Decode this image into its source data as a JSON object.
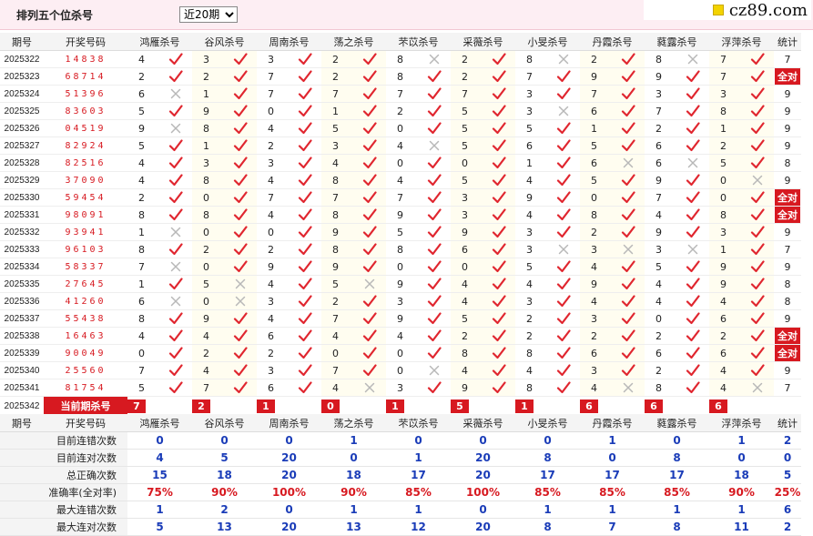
{
  "header": {
    "title": "排列五个位杀号",
    "select_value": "近20期",
    "brand": "cz89.com"
  },
  "columns": [
    "期号",
    "开奖号码",
    "鸿雁杀号",
    "谷风杀号",
    "周南杀号",
    "荡之杀号",
    "芣苡杀号",
    "采薇杀号",
    "小旻杀号",
    "丹霞杀号",
    "蕤露杀号",
    "浮萍杀号",
    "统计"
  ],
  "rows": [
    {
      "period": "2025322",
      "draw": "14838",
      "k": [
        [
          "4",
          1
        ],
        [
          "3",
          1
        ],
        [
          "3",
          1
        ],
        [
          "2",
          1
        ],
        [
          "8",
          0
        ],
        [
          "2",
          1
        ],
        [
          "8",
          0
        ],
        [
          "2",
          1
        ],
        [
          "8",
          0
        ],
        [
          "7",
          1
        ]
      ],
      "stat": "7"
    },
    {
      "period": "2025323",
      "draw": "68714",
      "k": [
        [
          "2",
          1
        ],
        [
          "2",
          1
        ],
        [
          "7",
          1
        ],
        [
          "2",
          1
        ],
        [
          "8",
          1
        ],
        [
          "2",
          1
        ],
        [
          "7",
          1
        ],
        [
          "9",
          1
        ],
        [
          "9",
          1
        ],
        [
          "7",
          1
        ]
      ],
      "stat": "全对"
    },
    {
      "period": "2025324",
      "draw": "51396",
      "k": [
        [
          "6",
          0
        ],
        [
          "1",
          1
        ],
        [
          "7",
          1
        ],
        [
          "7",
          1
        ],
        [
          "7",
          1
        ],
        [
          "7",
          1
        ],
        [
          "3",
          1
        ],
        [
          "7",
          1
        ],
        [
          "3",
          1
        ],
        [
          "3",
          1
        ]
      ],
      "stat": "9"
    },
    {
      "period": "2025325",
      "draw": "83603",
      "k": [
        [
          "5",
          1
        ],
        [
          "9",
          1
        ],
        [
          "0",
          1
        ],
        [
          "1",
          1
        ],
        [
          "2",
          1
        ],
        [
          "5",
          1
        ],
        [
          "3",
          0
        ],
        [
          "6",
          1
        ],
        [
          "7",
          1
        ],
        [
          "8",
          1
        ]
      ],
      "stat": "9"
    },
    {
      "period": "2025326",
      "draw": "04519",
      "k": [
        [
          "9",
          0
        ],
        [
          "8",
          1
        ],
        [
          "4",
          1
        ],
        [
          "5",
          1
        ],
        [
          "0",
          1
        ],
        [
          "5",
          1
        ],
        [
          "5",
          1
        ],
        [
          "1",
          1
        ],
        [
          "2",
          1
        ],
        [
          "1",
          1
        ]
      ],
      "stat": "9"
    },
    {
      "period": "2025327",
      "draw": "82924",
      "k": [
        [
          "5",
          1
        ],
        [
          "1",
          1
        ],
        [
          "2",
          1
        ],
        [
          "3",
          1
        ],
        [
          "4",
          0
        ],
        [
          "5",
          1
        ],
        [
          "6",
          1
        ],
        [
          "5",
          1
        ],
        [
          "6",
          1
        ],
        [
          "2",
          1
        ]
      ],
      "stat": "9"
    },
    {
      "period": "2025328",
      "draw": "82516",
      "k": [
        [
          "4",
          1
        ],
        [
          "3",
          1
        ],
        [
          "3",
          1
        ],
        [
          "4",
          1
        ],
        [
          "0",
          1
        ],
        [
          "0",
          1
        ],
        [
          "1",
          1
        ],
        [
          "6",
          0
        ],
        [
          "6",
          0
        ],
        [
          "5",
          1
        ]
      ],
      "stat": "8"
    },
    {
      "period": "2025329",
      "draw": "37090",
      "k": [
        [
          "4",
          1
        ],
        [
          "8",
          1
        ],
        [
          "4",
          1
        ],
        [
          "8",
          1
        ],
        [
          "4",
          1
        ],
        [
          "5",
          1
        ],
        [
          "4",
          1
        ],
        [
          "5",
          1
        ],
        [
          "9",
          1
        ],
        [
          "0",
          0
        ]
      ],
      "stat": "9"
    },
    {
      "period": "2025330",
      "draw": "59454",
      "k": [
        [
          "2",
          1
        ],
        [
          "0",
          1
        ],
        [
          "7",
          1
        ],
        [
          "7",
          1
        ],
        [
          "7",
          1
        ],
        [
          "3",
          1
        ],
        [
          "9",
          1
        ],
        [
          "0",
          1
        ],
        [
          "7",
          1
        ],
        [
          "0",
          1
        ]
      ],
      "stat": "全对"
    },
    {
      "period": "2025331",
      "draw": "98091",
      "k": [
        [
          "8",
          1
        ],
        [
          "8",
          1
        ],
        [
          "4",
          1
        ],
        [
          "8",
          1
        ],
        [
          "9",
          1
        ],
        [
          "3",
          1
        ],
        [
          "4",
          1
        ],
        [
          "8",
          1
        ],
        [
          "4",
          1
        ],
        [
          "8",
          1
        ]
      ],
      "stat": "全对"
    },
    {
      "period": "2025332",
      "draw": "93941",
      "k": [
        [
          "1",
          0
        ],
        [
          "0",
          1
        ],
        [
          "0",
          1
        ],
        [
          "9",
          1
        ],
        [
          "5",
          1
        ],
        [
          "9",
          1
        ],
        [
          "3",
          1
        ],
        [
          "2",
          1
        ],
        [
          "9",
          1
        ],
        [
          "3",
          1
        ]
      ],
      "stat": "9"
    },
    {
      "period": "2025333",
      "draw": "96103",
      "k": [
        [
          "8",
          1
        ],
        [
          "2",
          1
        ],
        [
          "2",
          1
        ],
        [
          "8",
          1
        ],
        [
          "8",
          1
        ],
        [
          "6",
          1
        ],
        [
          "3",
          0
        ],
        [
          "3",
          0
        ],
        [
          "3",
          0
        ],
        [
          "1",
          1
        ]
      ],
      "stat": "7"
    },
    {
      "period": "2025334",
      "draw": "58337",
      "k": [
        [
          "7",
          0
        ],
        [
          "0",
          1
        ],
        [
          "9",
          1
        ],
        [
          "9",
          1
        ],
        [
          "0",
          1
        ],
        [
          "0",
          1
        ],
        [
          "5",
          1
        ],
        [
          "4",
          1
        ],
        [
          "5",
          1
        ],
        [
          "9",
          1
        ]
      ],
      "stat": "9"
    },
    {
      "period": "2025335",
      "draw": "27645",
      "k": [
        [
          "1",
          1
        ],
        [
          "5",
          0
        ],
        [
          "4",
          1
        ],
        [
          "5",
          0
        ],
        [
          "9",
          1
        ],
        [
          "4",
          1
        ],
        [
          "4",
          1
        ],
        [
          "9",
          1
        ],
        [
          "4",
          1
        ],
        [
          "9",
          1
        ]
      ],
      "stat": "8"
    },
    {
      "period": "2025336",
      "draw": "41260",
      "k": [
        [
          "6",
          0
        ],
        [
          "0",
          0
        ],
        [
          "3",
          1
        ],
        [
          "2",
          1
        ],
        [
          "3",
          1
        ],
        [
          "4",
          1
        ],
        [
          "3",
          1
        ],
        [
          "4",
          1
        ],
        [
          "4",
          1
        ],
        [
          "4",
          1
        ]
      ],
      "stat": "8"
    },
    {
      "period": "2025337",
      "draw": "55438",
      "k": [
        [
          "8",
          1
        ],
        [
          "9",
          1
        ],
        [
          "4",
          1
        ],
        [
          "7",
          1
        ],
        [
          "9",
          1
        ],
        [
          "5",
          1
        ],
        [
          "2",
          1
        ],
        [
          "3",
          1
        ],
        [
          "0",
          1
        ],
        [
          "6",
          1
        ]
      ],
      "stat": "9"
    },
    {
      "period": "2025338",
      "draw": "16463",
      "k": [
        [
          "4",
          1
        ],
        [
          "4",
          1
        ],
        [
          "6",
          1
        ],
        [
          "4",
          1
        ],
        [
          "4",
          1
        ],
        [
          "2",
          1
        ],
        [
          "2",
          1
        ],
        [
          "2",
          1
        ],
        [
          "2",
          1
        ],
        [
          "2",
          1
        ]
      ],
      "stat": "全对"
    },
    {
      "period": "2025339",
      "draw": "90049",
      "k": [
        [
          "0",
          1
        ],
        [
          "2",
          1
        ],
        [
          "2",
          1
        ],
        [
          "0",
          1
        ],
        [
          "0",
          1
        ],
        [
          "8",
          1
        ],
        [
          "8",
          1
        ],
        [
          "6",
          1
        ],
        [
          "6",
          1
        ],
        [
          "6",
          1
        ]
      ],
      "stat": "全对"
    },
    {
      "period": "2025340",
      "draw": "25560",
      "k": [
        [
          "7",
          1
        ],
        [
          "4",
          1
        ],
        [
          "3",
          1
        ],
        [
          "7",
          1
        ],
        [
          "0",
          0
        ],
        [
          "4",
          1
        ],
        [
          "4",
          1
        ],
        [
          "3",
          1
        ],
        [
          "2",
          1
        ],
        [
          "4",
          1
        ]
      ],
      "stat": "9"
    },
    {
      "period": "2025341",
      "draw": "81754",
      "k": [
        [
          "5",
          1
        ],
        [
          "7",
          1
        ],
        [
          "6",
          1
        ],
        [
          "4",
          0
        ],
        [
          "3",
          1
        ],
        [
          "9",
          1
        ],
        [
          "8",
          1
        ],
        [
          "4",
          0
        ],
        [
          "8",
          1
        ],
        [
          "4",
          0
        ]
      ],
      "stat": "7"
    }
  ],
  "current": {
    "period": "2025342",
    "label": "当前期杀号",
    "values": [
      "7",
      "2",
      "1",
      "0",
      "1",
      "5",
      "1",
      "6",
      "6",
      "6"
    ]
  },
  "summary": {
    "labels": [
      "目前连错次数",
      "目前连对次数",
      "总正确次数",
      "准确率(全对率)",
      "最大连错次数",
      "最大连对次数"
    ],
    "values": [
      [
        "0",
        "0",
        "0",
        "1",
        "0",
        "0",
        "0",
        "1",
        "0",
        "1",
        "2"
      ],
      [
        "4",
        "5",
        "20",
        "0",
        "1",
        "20",
        "8",
        "0",
        "8",
        "0",
        "0"
      ],
      [
        "15",
        "18",
        "20",
        "18",
        "17",
        "20",
        "17",
        "17",
        "17",
        "18",
        "5"
      ],
      [
        "75%",
        "90%",
        "100%",
        "90%",
        "85%",
        "100%",
        "85%",
        "85%",
        "85%",
        "90%",
        "25%"
      ],
      [
        "1",
        "2",
        "0",
        "1",
        "1",
        "0",
        "1",
        "1",
        "1",
        "1",
        "6"
      ],
      [
        "5",
        "13",
        "20",
        "13",
        "12",
        "20",
        "8",
        "7",
        "8",
        "11",
        "2"
      ]
    ]
  },
  "colors": {
    "check": "#e0262f",
    "cross": "#b8b8b8",
    "accent": "#d71920",
    "blue": "#1a3cb8"
  },
  "icons": {
    "correct": "check-icon",
    "wrong": "cross-icon"
  }
}
